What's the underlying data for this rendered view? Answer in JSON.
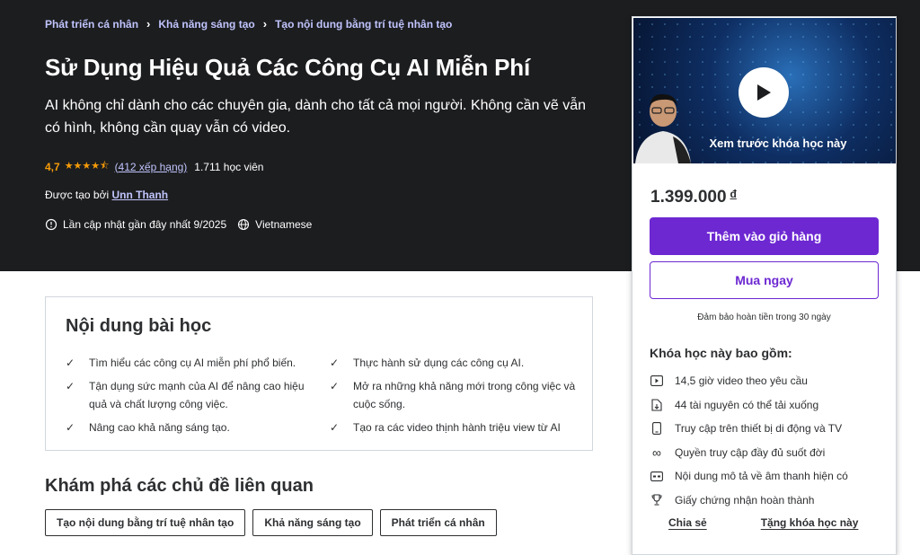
{
  "breadcrumb": [
    "Phát triển cá nhân",
    "Khả năng sáng tạo",
    "Tạo nội dung bằng trí tuệ nhân tạo"
  ],
  "course": {
    "title": "Sử Dụng Hiệu Quả Các Công Cụ AI Miễn Phí",
    "subtitle": "AI không chỉ dành cho các chuyên gia, dành cho tất cả mọi người. Không cần vẽ vẫn có hình, không cần quay vẫn có video.",
    "rating": "4,7",
    "stars": "★★★★⯪",
    "rating_count": "(412 xếp hạng)",
    "students": "1.711 học viên",
    "created_by_label": "Được tạo bởi",
    "instructor": "Unn Thanh",
    "updated": "Lần cập nhật gần đây nhất 9/2025",
    "language": "Vietnamese"
  },
  "card": {
    "preview_label": "Xem trước khóa học này",
    "price": "1.399.000",
    "currency": "đ",
    "add_to_cart": "Thêm vào giỏ hàng",
    "buy_now": "Mua ngay",
    "guarantee": "Đảm bảo hoàn tiền trong 30 ngày",
    "includes_title": "Khóa học này bao gồm:",
    "includes": [
      {
        "icon": "video-icon",
        "text": "14,5 giờ video theo yêu cầu"
      },
      {
        "icon": "download-file-icon",
        "text": "44 tài nguyên có thể tải xuống"
      },
      {
        "icon": "mobile-icon",
        "text": "Truy cập trên thiết bị di động và TV"
      },
      {
        "icon": "infinity-icon",
        "text": "Quyền truy cập đầy đủ suốt đời"
      },
      {
        "icon": "closed-caption-icon",
        "text": "Nội dung mô tả về âm thanh hiện có"
      },
      {
        "icon": "trophy-icon",
        "text": "Giấy chứng nhận hoàn thành"
      }
    ],
    "share": "Chia sẻ",
    "gift": "Tặng khóa học này"
  },
  "learn": {
    "title": "Nội dung bài học",
    "left": [
      "Tìm hiểu các công cụ AI miễn phí phổ biến.",
      "Tận dụng sức mạnh của AI để nâng cao hiệu quả và chất lượng công việc.",
      "Nâng cao khả năng sáng tạo."
    ],
    "right": [
      "Thực hành sử dụng các công cụ AI.",
      "Mở ra những khả năng mới trong công việc và cuộc sống.",
      "Tạo ra các video thịnh hành triệu view từ AI"
    ]
  },
  "related": {
    "title": "Khám phá các chủ đề liên quan",
    "tags": [
      "Tạo nội dung bằng trí tuệ nhân tạo",
      "Khả năng sáng tạo",
      "Phát triển cá nhân"
    ]
  },
  "colors": {
    "hero_bg": "#1c1d1f",
    "accent": "#6d28d2",
    "link": "#c0c4fc",
    "star": "#f69c08"
  }
}
